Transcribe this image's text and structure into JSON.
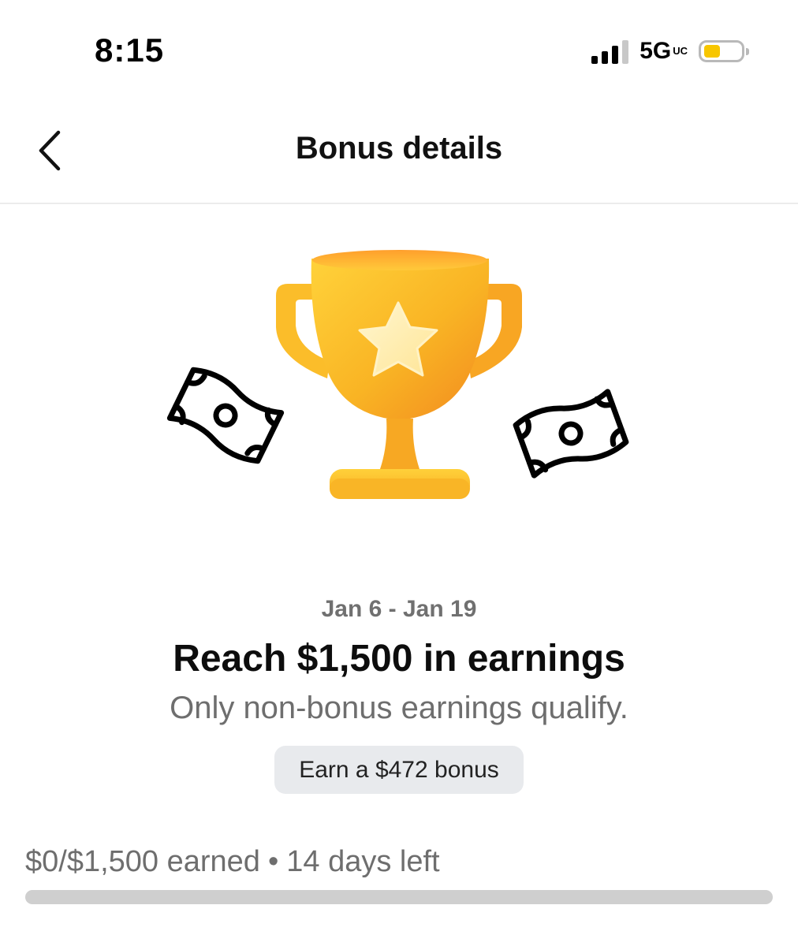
{
  "status_bar": {
    "time": "8:15",
    "network": "5G",
    "network_badge": "UC",
    "battery_color": "#f7c600"
  },
  "nav": {
    "title": "Bonus details",
    "back_icon": "chevron-left-icon"
  },
  "hero": {
    "icons": [
      "trophy-icon",
      "star-icon",
      "cash-bill-icon",
      "cash-bill-icon"
    ],
    "trophy_color": "#f9b21d",
    "bill_color": "#000000"
  },
  "bonus": {
    "date_range": "Jan 6 - Jan 19",
    "headline": "Reach $1,500 in earnings",
    "subtext": "Only non-bonus earnings qualify.",
    "pill_label": "Earn a $472 bonus"
  },
  "progress": {
    "earned_text": "$0/$1,500 earned",
    "separator": "•",
    "days_left_text": "14 days left",
    "earned": 0,
    "goal": 1500
  }
}
